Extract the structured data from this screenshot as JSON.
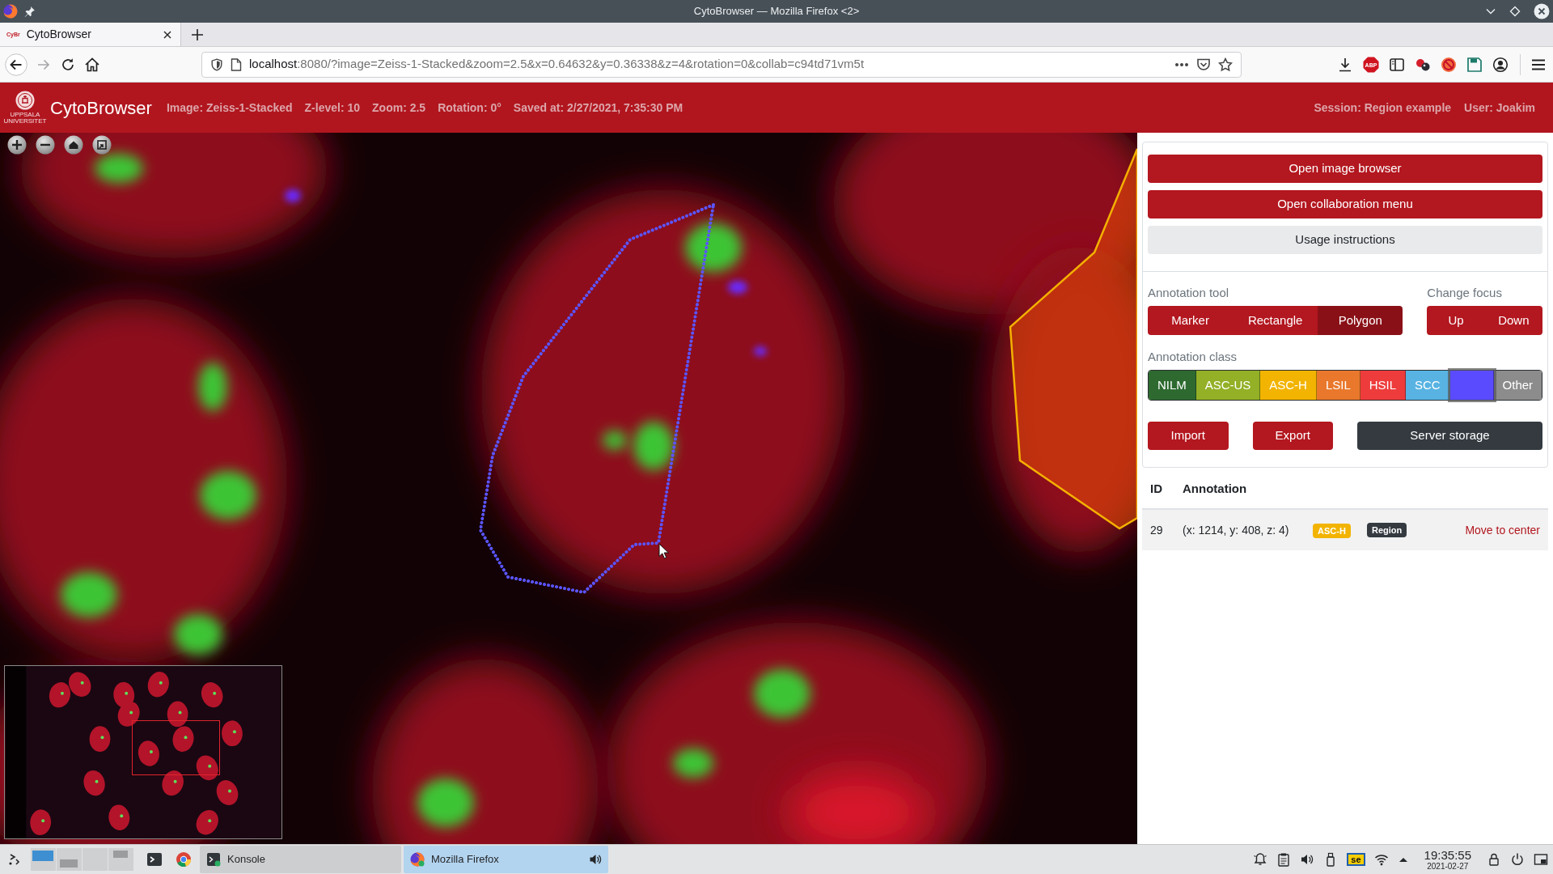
{
  "window": {
    "title": "CytoBrowser — Mozilla Firefox <2>"
  },
  "browser": {
    "tabs": [
      {
        "favicon": "CyBr",
        "title": "CytoBrowser",
        "selected": true
      }
    ],
    "url": {
      "host": "localhost",
      "rest": ":8080/?image=Zeiss-1-Stacked&zoom=2.5&x=0.64632&y=0.36338&z=4&rotation=0&collab=c94td71vm5t"
    },
    "extension_badge": "ABP"
  },
  "header": {
    "logo_text": "UPPSALA UNIVERSITET",
    "title": "CytoBrowser",
    "info": [
      "Image: Zeiss-1-Stacked",
      "Z-level: 10",
      "Zoom: 2.5",
      "Rotation: 0°",
      "Saved at: 2/27/2021, 7:35:30 PM"
    ],
    "session": "Session: Region example",
    "user": "User: Joakim"
  },
  "panel": {
    "menu_buttons": [
      {
        "label": "Open image browser",
        "kind": "primary"
      },
      {
        "label": "Open collaboration menu",
        "kind": "primary"
      },
      {
        "label": "Usage instructions",
        "kind": "light"
      }
    ],
    "annotation_tool": {
      "label": "Annotation tool",
      "tools": [
        {
          "label": "Marker",
          "selected": false
        },
        {
          "label": "Rectangle",
          "selected": false
        },
        {
          "label": "Polygon",
          "selected": true
        }
      ]
    },
    "change_focus": {
      "label": "Change focus",
      "buttons": [
        "Up",
        "Down"
      ]
    },
    "annotation_class": {
      "label": "Annotation class",
      "classes": [
        {
          "label": "NILM",
          "color": "#2e6a30",
          "selected": false
        },
        {
          "label": "ASC-US",
          "color": "#93b026",
          "selected": false
        },
        {
          "label": "ASC-H",
          "color": "#f2b400",
          "selected": false
        },
        {
          "label": "LSIL",
          "color": "#e9782c",
          "selected": false
        },
        {
          "label": "HSIL",
          "color": "#ee3c3c",
          "selected": false
        },
        {
          "label": "SCC",
          "color": "#58b3e2",
          "selected": false
        },
        {
          "color": "#5b4bff",
          "selected": true
        },
        {
          "label": "Other",
          "color": "#8c8c8c",
          "selected": false
        }
      ]
    },
    "file_buttons": [
      {
        "label": "Import",
        "kind": "primary"
      },
      {
        "label": "Export",
        "kind": "primary"
      },
      {
        "label": "Server storage",
        "kind": "dark"
      }
    ]
  },
  "annotations": {
    "columns": [
      "ID",
      "Annotation"
    ],
    "rows": [
      {
        "id": "29",
        "position": "(x: 1214, y: 408, z: 4)",
        "class": {
          "label": "ASC-H",
          "color": "#f2b400"
        },
        "shape": "Region",
        "action": "Move to center"
      }
    ]
  },
  "taskbar": {
    "tasks": [
      {
        "label": "Konsole",
        "selected": false
      },
      {
        "label": "Mozilla Firefox",
        "selected": true
      }
    ],
    "keyboard_layout": "se",
    "clock": {
      "time": "19:35:55",
      "date": "2021-02-27"
    }
  }
}
